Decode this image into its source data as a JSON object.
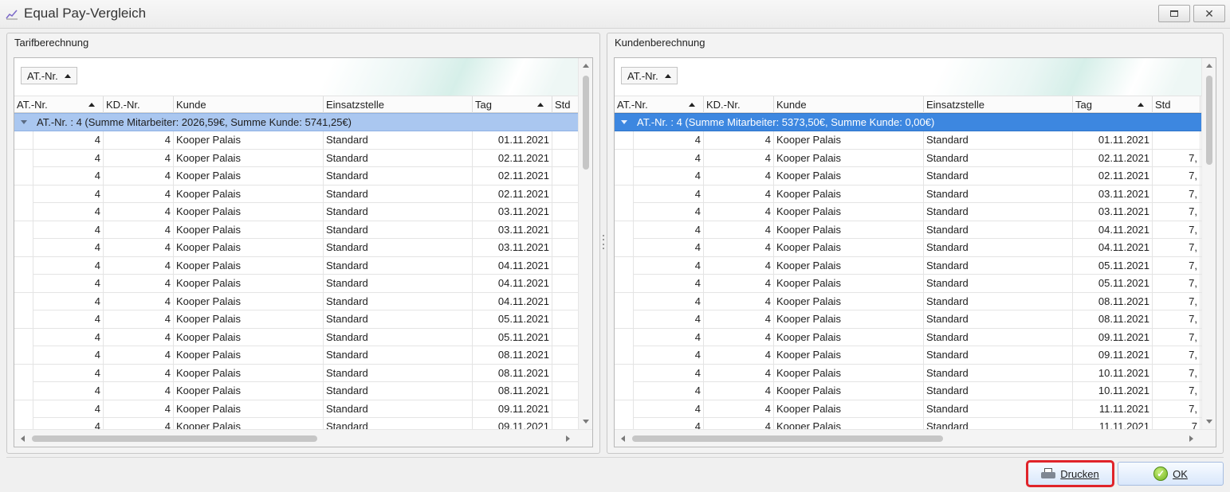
{
  "window": {
    "title": "Equal Pay-Vergleich",
    "icon": "chart-line-icon",
    "restore_icon": "restore-icon",
    "close_label": "✕"
  },
  "left_panel": {
    "title": "Tarifberechnung",
    "group_chip": "AT.-Nr.",
    "columns": [
      "AT.-Nr.",
      "KD.-Nr.",
      "Kunde",
      "Einsatzstelle",
      "Tag",
      "Std"
    ],
    "group_text": "AT.-Nr. : 4 (Summe Mitarbeiter: 2026,59€, Summe Kunde: 5741,25€)",
    "rows": [
      {
        "at": "4",
        "kd": "4",
        "kunde": "Kooper Palais",
        "einsatz": "Standard",
        "tag": "01.11.2021",
        "std": ""
      },
      {
        "at": "4",
        "kd": "4",
        "kunde": "Kooper Palais",
        "einsatz": "Standard",
        "tag": "02.11.2021",
        "std": ""
      },
      {
        "at": "4",
        "kd": "4",
        "kunde": "Kooper Palais",
        "einsatz": "Standard",
        "tag": "02.11.2021",
        "std": ""
      },
      {
        "at": "4",
        "kd": "4",
        "kunde": "Kooper Palais",
        "einsatz": "Standard",
        "tag": "02.11.2021",
        "std": ""
      },
      {
        "at": "4",
        "kd": "4",
        "kunde": "Kooper Palais",
        "einsatz": "Standard",
        "tag": "03.11.2021",
        "std": ""
      },
      {
        "at": "4",
        "kd": "4",
        "kunde": "Kooper Palais",
        "einsatz": "Standard",
        "tag": "03.11.2021",
        "std": ""
      },
      {
        "at": "4",
        "kd": "4",
        "kunde": "Kooper Palais",
        "einsatz": "Standard",
        "tag": "03.11.2021",
        "std": ""
      },
      {
        "at": "4",
        "kd": "4",
        "kunde": "Kooper Palais",
        "einsatz": "Standard",
        "tag": "04.11.2021",
        "std": ""
      },
      {
        "at": "4",
        "kd": "4",
        "kunde": "Kooper Palais",
        "einsatz": "Standard",
        "tag": "04.11.2021",
        "std": ""
      },
      {
        "at": "4",
        "kd": "4",
        "kunde": "Kooper Palais",
        "einsatz": "Standard",
        "tag": "04.11.2021",
        "std": ""
      },
      {
        "at": "4",
        "kd": "4",
        "kunde": "Kooper Palais",
        "einsatz": "Standard",
        "tag": "05.11.2021",
        "std": ""
      },
      {
        "at": "4",
        "kd": "4",
        "kunde": "Kooper Palais",
        "einsatz": "Standard",
        "tag": "05.11.2021",
        "std": ""
      },
      {
        "at": "4",
        "kd": "4",
        "kunde": "Kooper Palais",
        "einsatz": "Standard",
        "tag": "08.11.2021",
        "std": ""
      },
      {
        "at": "4",
        "kd": "4",
        "kunde": "Kooper Palais",
        "einsatz": "Standard",
        "tag": "08.11.2021",
        "std": ""
      },
      {
        "at": "4",
        "kd": "4",
        "kunde": "Kooper Palais",
        "einsatz": "Standard",
        "tag": "08.11.2021",
        "std": ""
      },
      {
        "at": "4",
        "kd": "4",
        "kunde": "Kooper Palais",
        "einsatz": "Standard",
        "tag": "09.11.2021",
        "std": ""
      },
      {
        "at": "4",
        "kd": "4",
        "kunde": "Kooper Palais",
        "einsatz": "Standard",
        "tag": "09.11.2021",
        "std": ""
      }
    ]
  },
  "right_panel": {
    "title": "Kundenberechnung",
    "group_chip": "AT.-Nr.",
    "columns": [
      "AT.-Nr.",
      "KD.-Nr.",
      "Kunde",
      "Einsatzstelle",
      "Tag",
      "Std"
    ],
    "group_text": "AT.-Nr. : 4 (Summe Mitarbeiter: 5373,50€, Summe Kunde: 0,00€)",
    "rows": [
      {
        "at": "4",
        "kd": "4",
        "kunde": "Kooper Palais",
        "einsatz": "Standard",
        "tag": "01.11.2021",
        "std": ""
      },
      {
        "at": "4",
        "kd": "4",
        "kunde": "Kooper Palais",
        "einsatz": "Standard",
        "tag": "02.11.2021",
        "std": "7,"
      },
      {
        "at": "4",
        "kd": "4",
        "kunde": "Kooper Palais",
        "einsatz": "Standard",
        "tag": "02.11.2021",
        "std": "7,"
      },
      {
        "at": "4",
        "kd": "4",
        "kunde": "Kooper Palais",
        "einsatz": "Standard",
        "tag": "03.11.2021",
        "std": "7,"
      },
      {
        "at": "4",
        "kd": "4",
        "kunde": "Kooper Palais",
        "einsatz": "Standard",
        "tag": "03.11.2021",
        "std": "7,"
      },
      {
        "at": "4",
        "kd": "4",
        "kunde": "Kooper Palais",
        "einsatz": "Standard",
        "tag": "04.11.2021",
        "std": "7,"
      },
      {
        "at": "4",
        "kd": "4",
        "kunde": "Kooper Palais",
        "einsatz": "Standard",
        "tag": "04.11.2021",
        "std": "7,"
      },
      {
        "at": "4",
        "kd": "4",
        "kunde": "Kooper Palais",
        "einsatz": "Standard",
        "tag": "05.11.2021",
        "std": "7,"
      },
      {
        "at": "4",
        "kd": "4",
        "kunde": "Kooper Palais",
        "einsatz": "Standard",
        "tag": "05.11.2021",
        "std": "7,"
      },
      {
        "at": "4",
        "kd": "4",
        "kunde": "Kooper Palais",
        "einsatz": "Standard",
        "tag": "08.11.2021",
        "std": "7,"
      },
      {
        "at": "4",
        "kd": "4",
        "kunde": "Kooper Palais",
        "einsatz": "Standard",
        "tag": "08.11.2021",
        "std": "7,"
      },
      {
        "at": "4",
        "kd": "4",
        "kunde": "Kooper Palais",
        "einsatz": "Standard",
        "tag": "09.11.2021",
        "std": "7,"
      },
      {
        "at": "4",
        "kd": "4",
        "kunde": "Kooper Palais",
        "einsatz": "Standard",
        "tag": "09.11.2021",
        "std": "7,"
      },
      {
        "at": "4",
        "kd": "4",
        "kunde": "Kooper Palais",
        "einsatz": "Standard",
        "tag": "10.11.2021",
        "std": "7,"
      },
      {
        "at": "4",
        "kd": "4",
        "kunde": "Kooper Palais",
        "einsatz": "Standard",
        "tag": "10.11.2021",
        "std": "7,"
      },
      {
        "at": "4",
        "kd": "4",
        "kunde": "Kooper Palais",
        "einsatz": "Standard",
        "tag": "11.11.2021",
        "std": "7,"
      },
      {
        "at": "4",
        "kd": "4",
        "kunde": "Kooper Palais",
        "einsatz": "Standard",
        "tag": "11.11.2021",
        "std": "7"
      }
    ]
  },
  "buttons": {
    "print_label": "Drucken",
    "print_icon": "printer-icon",
    "ok_label": "OK",
    "ok_icon": "check-icon"
  },
  "colors": {
    "group_row_left": "#aac7f0",
    "group_row_right": "#3d87e0",
    "highlight_border": "#e0242a"
  }
}
